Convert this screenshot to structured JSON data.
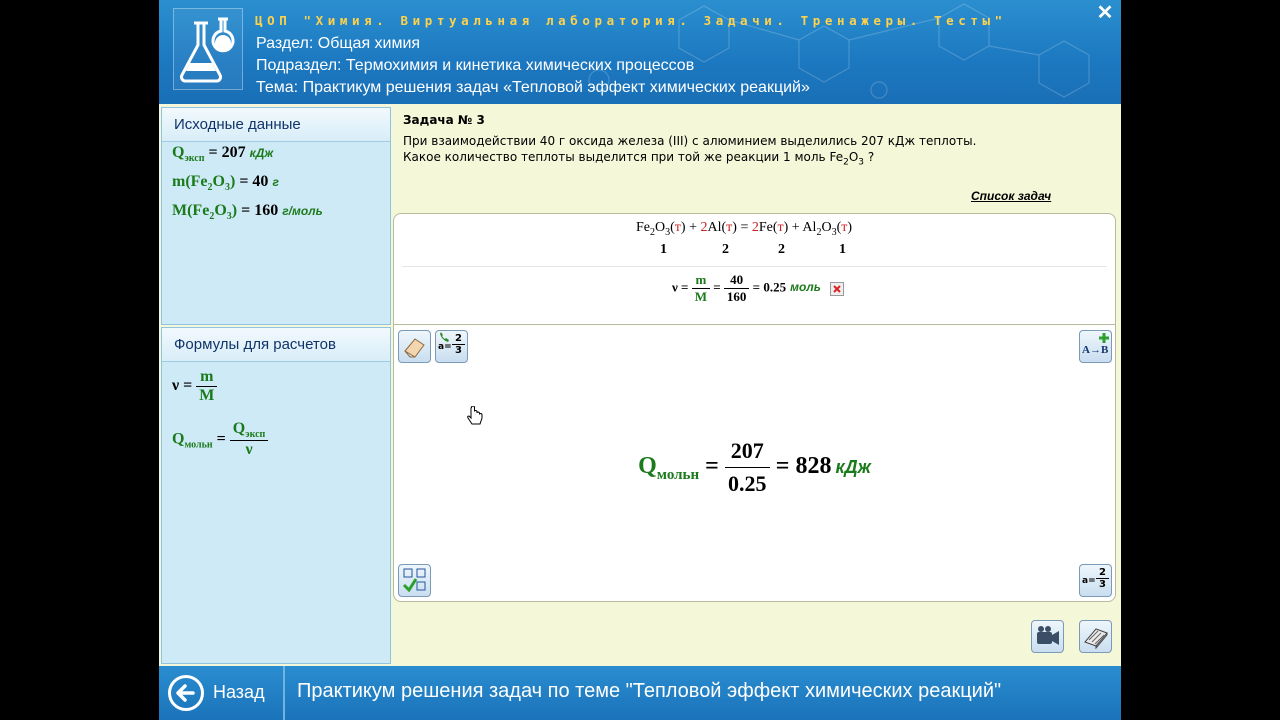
{
  "header": {
    "brand": "ЦОП \"Химия. Виртуальная лаборатория. Задачи. Тренажеры. Тесты\"",
    "section": "Раздел: Общая химия",
    "subsection": "Подраздел: Термохимия и кинетика химических процессов",
    "topic": "Тема: Практикум решения задач «Тепловой эффект химических реакций»",
    "close_label": "✕"
  },
  "given": {
    "title": "Исходные данные",
    "q_label": "Q",
    "q_sub": "эксп",
    "q_value": "= 207",
    "q_unit": "кДж",
    "m_label": "m(Fe",
    "m_value": "= 40",
    "m_unit": "г",
    "M_label": "M(Fe",
    "M_value": "= 160",
    "M_unit": "г/моль"
  },
  "formulas": {
    "title": "Формулы для расчетов",
    "nu": "ν =",
    "m": "m",
    "M": "M",
    "q_label": "Q",
    "q_sub": "мольн",
    "eq": "=",
    "q_exp": "Q",
    "q_exp_sub": "эксп",
    "nu_den": "ν"
  },
  "task": {
    "title": "Задача № 3",
    "text_before": "При взаимодействии 40 г оксида железа (III) с алюминием выделились 207 кДж теплоты. Какое количество теплоты выделится при той же реакции 1 моль Fe",
    "text_after": " ?",
    "list_link": "Список задач"
  },
  "reaction": {
    "coefficients": [
      "1",
      "2",
      "2",
      "1"
    ],
    "calc_nu": "ν =",
    "calc_m": "m",
    "calc_M": "M",
    "calc_num": "40",
    "calc_den": "160",
    "calc_result": "= 0.25",
    "calc_unit": "моль"
  },
  "result": {
    "label": "Q",
    "sub": "мольн",
    "eq": "=",
    "num": "207",
    "den": "0.25",
    "value": "= 828",
    "unit": "кДж"
  },
  "tools": {
    "frac_a": "a=",
    "frac_n": "2",
    "frac_d": "3",
    "ab": "A→B"
  },
  "footer": {
    "back_label": "Назад",
    "title": "Практикум решения задач по теме \"Тепловой эффект химических реакций\""
  },
  "colors": {
    "header_blue": "#1c78c0",
    "panel_blue": "#cfeaf7",
    "formula_green": "#1b7a1b",
    "brand_yellow": "#ffd24a",
    "background": "#f4f7d8"
  }
}
